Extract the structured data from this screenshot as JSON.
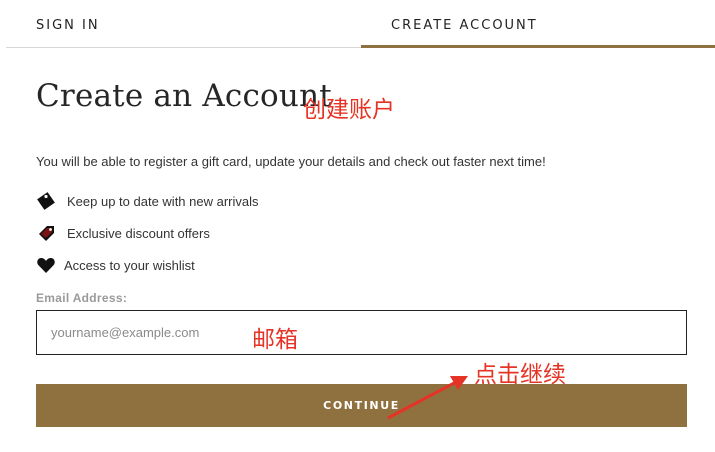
{
  "tabs": [
    {
      "label": "SIGN IN",
      "active": false
    },
    {
      "label": "CREATE ACCOUNT",
      "active": true
    }
  ],
  "page": {
    "title": "Create an Account",
    "intro": "You will be able to register a gift card, update your details and check out faster next time!"
  },
  "benefits": [
    {
      "icon": "tag-icon",
      "label": "Keep up to date with new arrivals"
    },
    {
      "icon": "discount-tag-icon",
      "label": "Exclusive discount offers"
    },
    {
      "icon": "heart-icon",
      "label": "Access to your wishlist"
    }
  ],
  "form": {
    "email_label": "Email Address:",
    "email_placeholder": "yourname@example.com",
    "email_value": "",
    "continue_label": "CONTINUE"
  },
  "annotations": {
    "create_account": "创建账户",
    "email": "邮箱",
    "click_continue": "点击继续"
  },
  "colors": {
    "accent": "#8f7140",
    "annotation": "#e53325"
  }
}
